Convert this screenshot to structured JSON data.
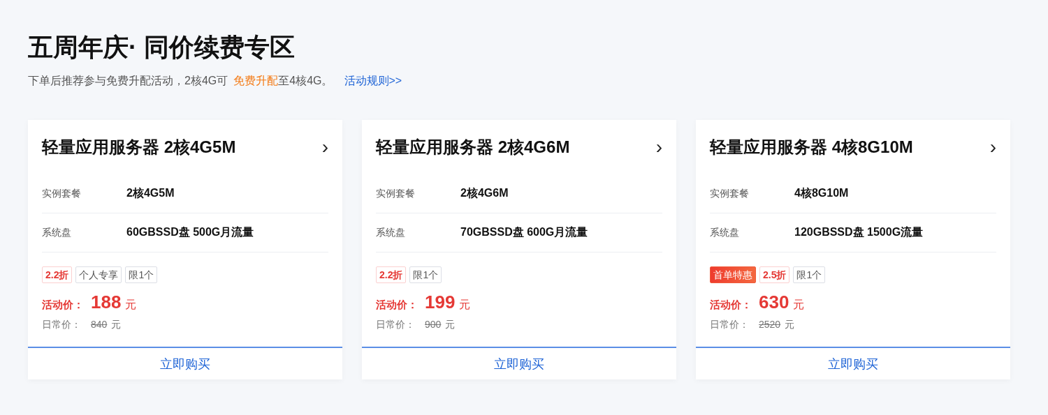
{
  "title": "五周年庆· 同价续费专区",
  "subtitle": [
    {
      "kind": "text",
      "text": "下单后推荐参与免费升配活动，2核4G可"
    },
    {
      "kind": "highlight",
      "text": "免费升配"
    },
    {
      "kind": "text",
      "text": "至4核4G。"
    },
    {
      "kind": "link",
      "text": "活动规则>>"
    }
  ],
  "cards": [
    {
      "title": "轻量应用服务器 2核4G5M",
      "arrow": "›",
      "specs": [
        {
          "label": "实例套餐",
          "value": "2核4G5M"
        },
        {
          "label": "系统盘",
          "value": "60GBSSD盘 500G月流量"
        }
      ],
      "tags": [
        {
          "kind": "discount",
          "text": "2.2折"
        },
        {
          "kind": "plain",
          "text": "个人专享"
        },
        {
          "kind": "plain",
          "text": "限1个"
        }
      ],
      "price_label": "活动价：",
      "price": "188",
      "price_unit": "元",
      "regular_label": "日常价：",
      "regular": "840",
      "regular_unit": "元",
      "button": "立即购买"
    },
    {
      "title": "轻量应用服务器 2核4G6M",
      "arrow": "›",
      "specs": [
        {
          "label": "实例套餐",
          "value": "2核4G6M"
        },
        {
          "label": "系统盘",
          "value": "70GBSSD盘 600G月流量"
        }
      ],
      "tags": [
        {
          "kind": "discount",
          "text": "2.2折"
        },
        {
          "kind": "plain",
          "text": "限1个"
        }
      ],
      "price_label": "活动价：",
      "price": "199",
      "price_unit": "元",
      "regular_label": "日常价：",
      "regular": "900",
      "regular_unit": "元",
      "button": "立即购买"
    },
    {
      "title": "轻量应用服务器 4核8G10M",
      "arrow": "›",
      "specs": [
        {
          "label": "实例套餐",
          "value": "4核8G10M"
        },
        {
          "label": "系统盘",
          "value": "120GBSSD盘 1500G流量"
        }
      ],
      "tags": [
        {
          "kind": "promo",
          "text": "首单特惠"
        },
        {
          "kind": "discount",
          "text": "2.5折"
        },
        {
          "kind": "plain",
          "text": "限1个"
        }
      ],
      "price_label": "活动价：",
      "price": "630",
      "price_unit": "元",
      "regular_label": "日常价：",
      "regular": "2520",
      "regular_unit": "元",
      "button": "立即购买"
    }
  ]
}
